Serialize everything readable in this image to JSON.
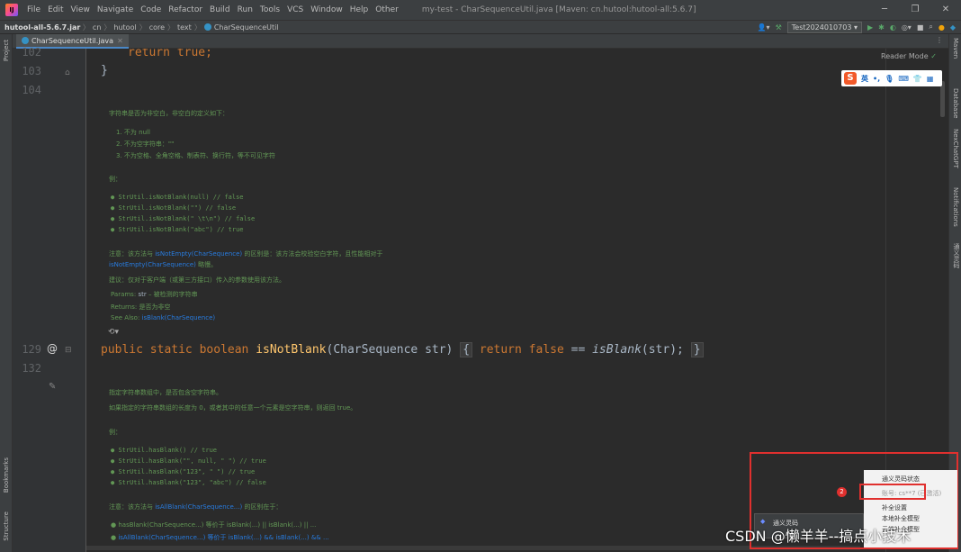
{
  "menubar": {
    "items": [
      "File",
      "Edit",
      "View",
      "Navigate",
      "Code",
      "Refactor",
      "Build",
      "Run",
      "Tools",
      "VCS",
      "Window",
      "Help",
      "Other"
    ],
    "title": "my-test - CharSequenceUtil.java [Maven: cn.hutool:hutool-all:5.6.7]"
  },
  "navbar": {
    "project": "hutool-all-5.6.7.jar",
    "crumbs": [
      "cn",
      "hutool",
      "core",
      "text",
      "CharSequenceUtil"
    ],
    "run_config": "Test2024010703"
  },
  "tab": {
    "label": "CharSequenceUtil.java"
  },
  "left_tools": {
    "project": "Project",
    "bookmarks": "Bookmarks",
    "structure": "Structure"
  },
  "right_tools": {
    "maven": "Maven",
    "database": "Database",
    "chatgpt": "NexChatGPT",
    "notifications": "Notifications",
    "translate": "通义灵码"
  },
  "editor": {
    "reader_mode": "Reader Mode",
    "line_numbers": [
      "102",
      "103",
      "104",
      "129",
      "132"
    ],
    "code_102": "return true;",
    "code_103": "}",
    "sig_public": "public",
    "sig_static": "static",
    "sig_boolean": "boolean",
    "sig_name": "isNotBlank",
    "sig_params": "(CharSequence str)",
    "sig_body_kw": "return false",
    "sig_body_op": "==",
    "sig_body_call": "isBlank",
    "sig_body_args": "(str);",
    "doc1": {
      "intro": "字符串是否为非空白，非空白的定义如下：",
      "list": [
        "1. 不为 null",
        "2. 不为空字符串：\"\"",
        "3. 不为空格、全角空格、制表符、换行符，等不可见字符"
      ],
      "example_label": "例：",
      "examples": [
        "StrUtil.isNotBlank(null) // false",
        "StrUtil.isNotBlank(\"\") // false",
        "StrUtil.isNotBlank(\" \\t\\n\") // false",
        "StrUtil.isNotBlank(\"abc\") // true"
      ],
      "note_prefix": "注意：该方法与",
      "note_link1": "isNotEmpty(CharSequence)",
      "note_mid": "的区别是：该方法会校验空白字符，且性能相对于",
      "note_link2": "isNotEmpty(CharSequence)",
      "note_end": "略慢。",
      "advice": "建议：仅对于客户端（或第三方接口）传入的参数使用该方法。",
      "params_label": "Params:",
      "params_name": "str",
      "params_desc": "– 被检测的字符串",
      "returns_label": "Returns:",
      "returns_desc": "是否为非空",
      "see_label": "See Also:",
      "see_link": "isBlank(CharSequence)"
    },
    "doc2": {
      "intro": "指定字符串数组中，是否包含空字符串。",
      "detail": "如果指定的字符串数组的长度为 0，或者其中的任意一个元素是空字符串，则返回 true。",
      "example_label": "例：",
      "examples": [
        "StrUtil.hasBlank() // true",
        "StrUtil.hasBlank(\"\", null, \" \") // true",
        "StrUtil.hasBlank(\"123\", \" \") // true",
        "StrUtil.hasBlank(\"123\", \"abc\") // false"
      ],
      "note_prefix": "注意：该方法与",
      "note_link": "isAllBlank(CharSequence...)",
      "note_end": "的区别在于：",
      "bullet1": "hasBlank(CharSequence...) 等价于 isBlank(...) || isBlank(...) || ...",
      "bullet2": "isAllBlank(CharSequence...) 等价于 isBlank(...) && isBlank(...) && ..."
    }
  },
  "sogou": {
    "label": "英"
  },
  "popup_menu": {
    "items": [
      "通义灵码状态",
      "账号: cs**7 (已激活)",
      "补全设置",
      "本地补全模型",
      "云端补全模型"
    ],
    "badge": "2"
  },
  "notification": {
    "title": "通义灵码"
  },
  "watermark": "CSDN @懒羊羊--搞点小技术",
  "colors": {
    "keyword": "#cc7832",
    "function": "#ffc66d",
    "doc": "#629755",
    "link": "#287bde",
    "highlight": "#e0302e"
  }
}
